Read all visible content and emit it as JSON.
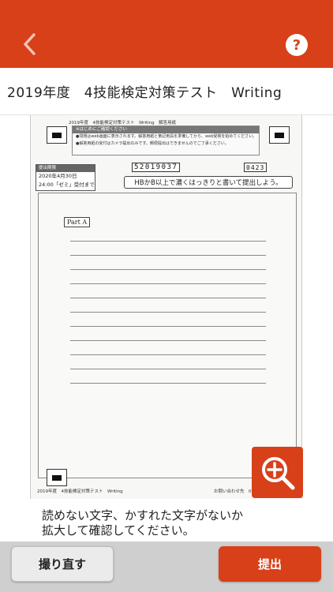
{
  "theme": {
    "accent": "#d8401a",
    "bar_gray": "#cfcfcf"
  },
  "header": {
    "back_icon": "chevron-left-icon",
    "help_label": "?"
  },
  "title": "2019年度　4技能検定対策テスト　Writing",
  "sheet": {
    "header_text": "2019年度　4技能検定対策テスト　Writing　解答用紙",
    "notice_title": "※はじめにご確認ください",
    "notice_line1": "●問題はweb画面に表示されます。解答用紙と筆記用具を準備してから、web受検を始めてください。",
    "notice_line2": "●解答用紙の受付はカメラ提出のみです。郵便提出はできませんのでご了承ください。",
    "deadline_title": "提出期限",
    "deadline_date": "2020年4月30日",
    "deadline_time": "24:00「ゼミ」受付まで",
    "student_id": "52019037",
    "side_number": "0423",
    "instruction": "HBかB以上で濃くはっきりと書いて提出しよう。",
    "part_label": "Part A",
    "footer_left": "2019年度　4技能検定対策テスト　Writing",
    "footer_right": "お問い合わせ先　0120-929-"
  },
  "zoom_icon": "zoom-in-icon",
  "message": {
    "line1": "読めない文字、かすれた文字がないか",
    "line2": "拡大して確認してください。"
  },
  "actions": {
    "retake_label": "撮り直す",
    "submit_label": "提出"
  }
}
